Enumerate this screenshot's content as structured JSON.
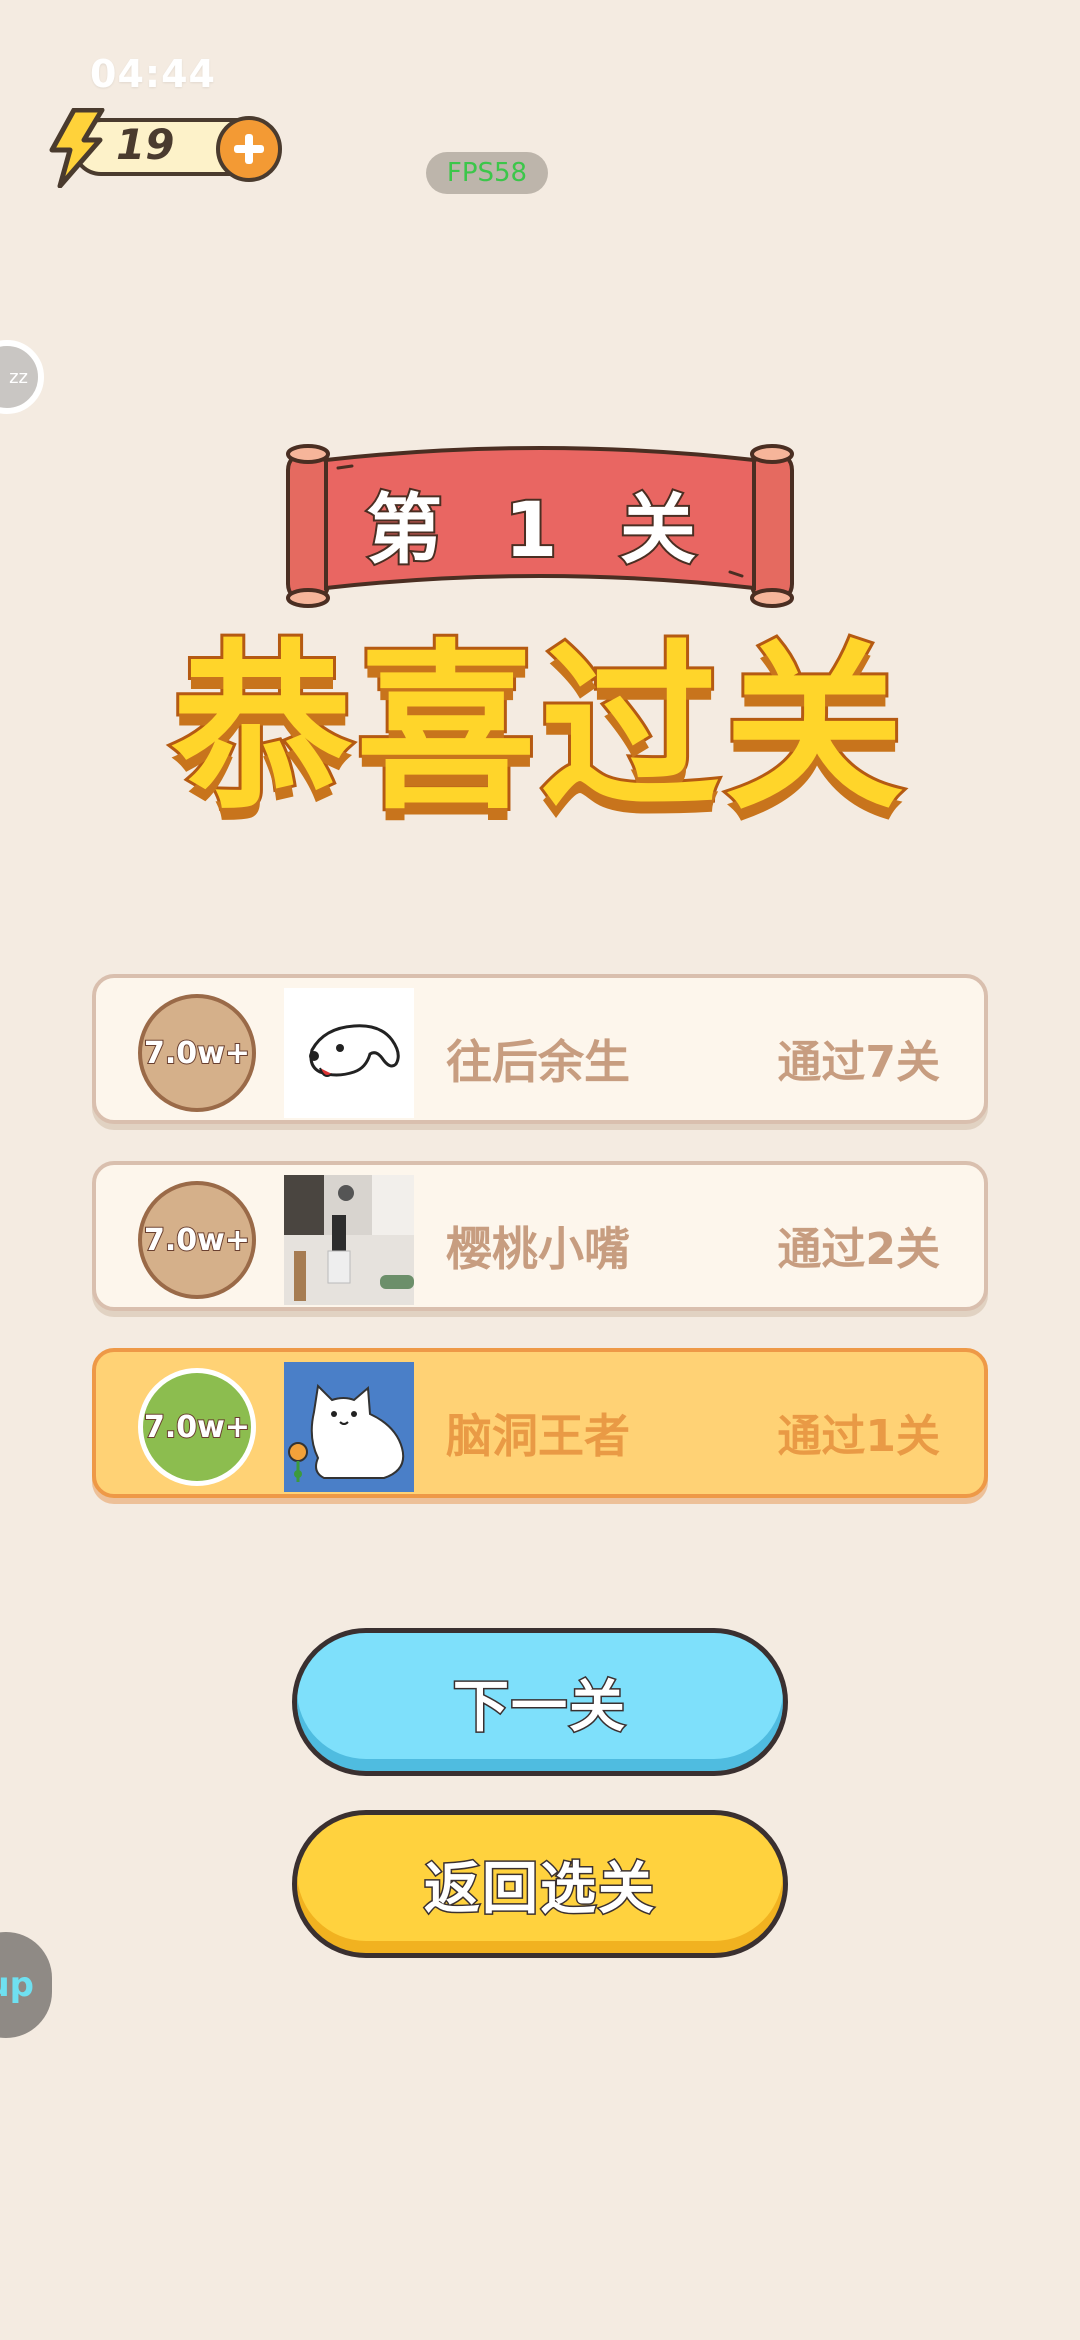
{
  "status": {
    "time": "04:44"
  },
  "energy": {
    "count": "19",
    "add_icon": "plus-icon",
    "bolt_icon": "lightning-icon"
  },
  "debug": {
    "fps": "FPS58"
  },
  "side": {
    "top_label": "zz",
    "bottom_label": "up"
  },
  "banner": {
    "level_label": "第 1 关"
  },
  "title": {
    "text": "恭喜过关"
  },
  "ranking": [
    {
      "badge": "7.0w+",
      "name": "往后余生",
      "levels": "通过7关"
    },
    {
      "badge": "7.0w+",
      "name": "樱桃小嘴",
      "levels": "通过2关"
    },
    {
      "badge": "7.0w+",
      "name": "脑洞王者",
      "levels": "通过1关"
    }
  ],
  "buttons": {
    "next": "下一关",
    "back": "返回选关"
  },
  "colors": {
    "background": "#f4ebe1",
    "ribbon": "#e96662",
    "title_fill": "#ffd52a",
    "next_button": "#7ee0fb",
    "back_button": "#ffd23e",
    "highlight_row": "#ffd275"
  }
}
